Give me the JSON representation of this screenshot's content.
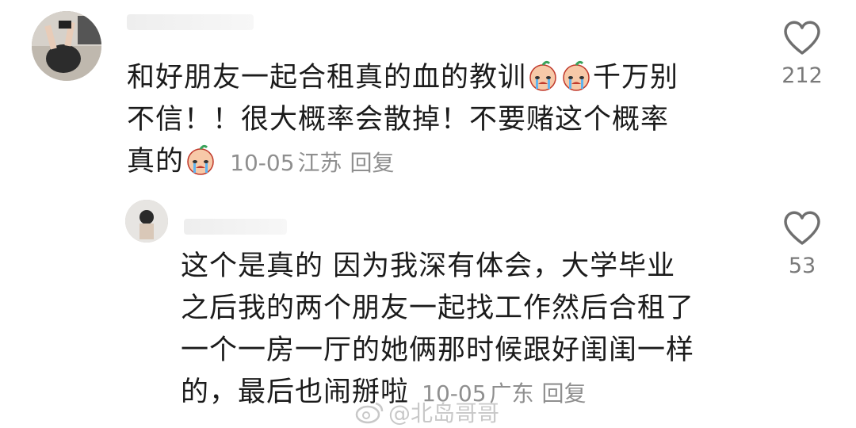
{
  "comments": [
    {
      "text_lines": [
        "和好朋友一起合租真的血的教训",
        "千万别",
        "不信！！很大概率会散掉！不要赌这个概率",
        "真的"
      ],
      "time": "10-05",
      "location": "江苏",
      "reply_label": "回复",
      "likes": "212",
      "emoji": "crying-face"
    },
    {
      "text_lines": [
        "这个是真的 因为我深有体会，大学毕业",
        "之后我的两个朋友一起找工作然后合租了",
        "一个一房一厅的她俩那时候跟好闺闺一样",
        "的，最后也闹掰啦"
      ],
      "time": "10-05",
      "location": "广东",
      "reply_label": "回复",
      "likes": "53"
    }
  ],
  "watermark": "@北岛哥哥",
  "colors": {
    "text": "#1b1b1b",
    "meta": "#8f8f8f",
    "heart": "#7a7a7a"
  }
}
